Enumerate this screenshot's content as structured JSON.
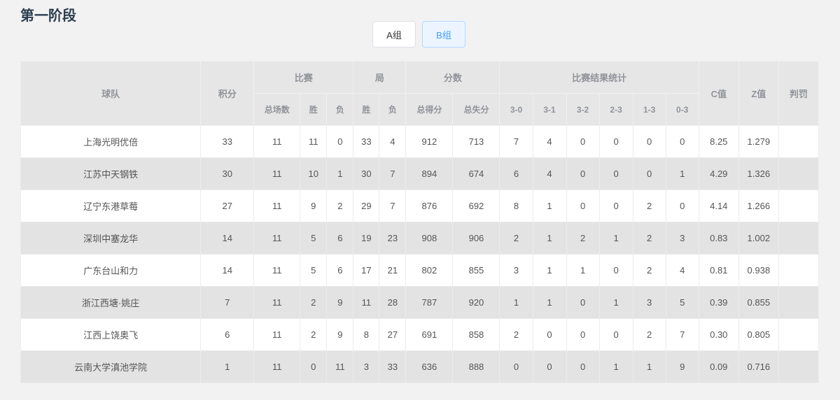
{
  "stage_title": "第一阶段",
  "tabs": [
    {
      "label": "A组",
      "active": false
    },
    {
      "label": "B组",
      "active": true
    }
  ],
  "headers": {
    "team": "球队",
    "points": "积分",
    "matches": "比赛",
    "sets": "局",
    "scores": "分数",
    "result_stats": "比赛结果统计",
    "c_value": "C值",
    "z_value": "Z值",
    "penalty": "判罚",
    "sub": {
      "total_matches": "总场数",
      "match_win": "胜",
      "match_loss": "负",
      "set_win": "胜",
      "set_loss": "负",
      "total_scored": "总得分",
      "total_lost": "总失分",
      "r30": "3-0",
      "r31": "3-1",
      "r32": "3-2",
      "r23": "2-3",
      "r13": "1-3",
      "r03": "0-3"
    }
  },
  "rows": [
    {
      "team": "上海光明优倍",
      "points": "33",
      "total": "11",
      "mw": "11",
      "ml": "0",
      "sw": "33",
      "sl": "4",
      "scored": "912",
      "lost": "713",
      "r30": "7",
      "r31": "4",
      "r32": "0",
      "r23": "0",
      "r13": "0",
      "r03": "0",
      "c": "8.25",
      "z": "1.279",
      "penalty": ""
    },
    {
      "team": "江苏中天钢铁",
      "points": "30",
      "total": "11",
      "mw": "10",
      "ml": "1",
      "sw": "30",
      "sl": "7",
      "scored": "894",
      "lost": "674",
      "r30": "6",
      "r31": "4",
      "r32": "0",
      "r23": "0",
      "r13": "0",
      "r03": "1",
      "c": "4.29",
      "z": "1.326",
      "penalty": ""
    },
    {
      "team": "辽宁东港草莓",
      "points": "27",
      "total": "11",
      "mw": "9",
      "ml": "2",
      "sw": "29",
      "sl": "7",
      "scored": "876",
      "lost": "692",
      "r30": "8",
      "r31": "1",
      "r32": "0",
      "r23": "0",
      "r13": "2",
      "r03": "0",
      "c": "4.14",
      "z": "1.266",
      "penalty": ""
    },
    {
      "team": "深圳中塞龙华",
      "points": "14",
      "total": "11",
      "mw": "5",
      "ml": "6",
      "sw": "19",
      "sl": "23",
      "scored": "908",
      "lost": "906",
      "r30": "2",
      "r31": "1",
      "r32": "2",
      "r23": "1",
      "r13": "2",
      "r03": "3",
      "c": "0.83",
      "z": "1.002",
      "penalty": ""
    },
    {
      "team": "广东台山和力",
      "points": "14",
      "total": "11",
      "mw": "5",
      "ml": "6",
      "sw": "17",
      "sl": "21",
      "scored": "802",
      "lost": "855",
      "r30": "3",
      "r31": "1",
      "r32": "1",
      "r23": "0",
      "r13": "2",
      "r03": "4",
      "c": "0.81",
      "z": "0.938",
      "penalty": ""
    },
    {
      "team": "浙江西塘·姚庄",
      "points": "7",
      "total": "11",
      "mw": "2",
      "ml": "9",
      "sw": "11",
      "sl": "28",
      "scored": "787",
      "lost": "920",
      "r30": "1",
      "r31": "1",
      "r32": "0",
      "r23": "1",
      "r13": "3",
      "r03": "5",
      "c": "0.39",
      "z": "0.855",
      "penalty": ""
    },
    {
      "team": "江西上饶奥飞",
      "points": "6",
      "total": "11",
      "mw": "2",
      "ml": "9",
      "sw": "8",
      "sl": "27",
      "scored": "691",
      "lost": "858",
      "r30": "2",
      "r31": "0",
      "r32": "0",
      "r23": "0",
      "r13": "2",
      "r03": "7",
      "c": "0.30",
      "z": "0.805",
      "penalty": ""
    },
    {
      "team": "云南大学滇池学院",
      "points": "1",
      "total": "11",
      "mw": "0",
      "ml": "11",
      "sw": "3",
      "sl": "33",
      "scored": "636",
      "lost": "888",
      "r30": "0",
      "r31": "0",
      "r32": "0",
      "r23": "1",
      "r13": "1",
      "r03": "9",
      "c": "0.09",
      "z": "0.716",
      "penalty": ""
    }
  ]
}
